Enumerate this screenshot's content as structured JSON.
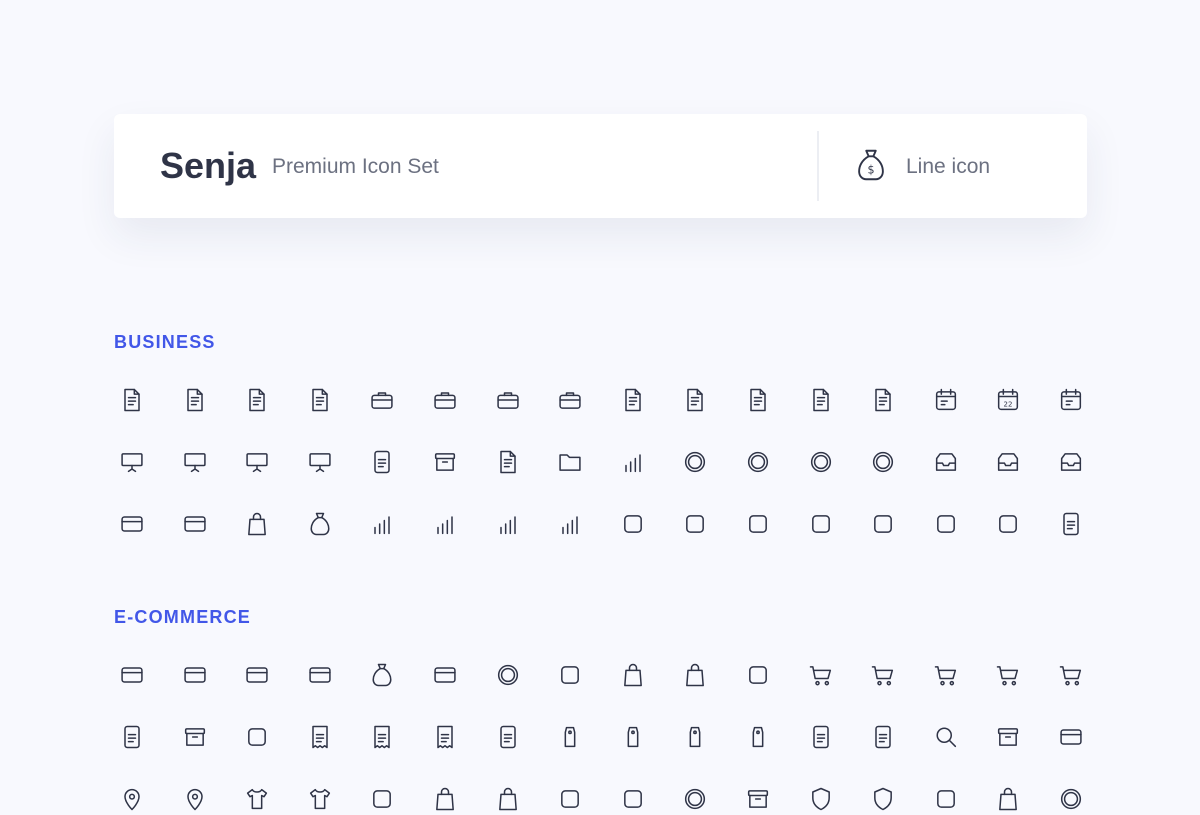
{
  "header": {
    "brand": "Senja",
    "tagline": "Premium Icon Set",
    "style_label": "Line icon",
    "style_icon": "money-bag-icon"
  },
  "colors": {
    "background": "#f8f9fe",
    "accent": "#4257e8",
    "icon_stroke": "#2f3447",
    "text_muted": "#6c7181"
  },
  "sections": [
    {
      "title": "BUSINESS",
      "icons": [
        "contact-book-icon",
        "address-book-at-icon",
        "checklist-document-icon",
        "document-lines-icon",
        "toolbox-icon",
        "briefcase-icon",
        "briefcase-rounded-icon",
        "suitcase-icon",
        "text-document-icon",
        "document-add-icon",
        "document-remove-icon",
        "document-check-icon",
        "document-delete-icon",
        "calendar-icon",
        "calendar-date-icon",
        "calendar-checklist-icon",
        "presentation-board-icon",
        "presentation-bar-chart-icon",
        "presentation-line-chart-icon",
        "presentation-down-chart-icon",
        "calculator-icon",
        "archive-drawer-icon",
        "list-document-icon",
        "folder-icon",
        "pie-chart-icon",
        "alarm-clock-icon",
        "dollar-coin-icon",
        "target-goal-icon",
        "crosshair-icon",
        "inbox-add-icon",
        "inbox-upload-icon",
        "inbox-mail-icon",
        "cash-stack-icon",
        "money-transfer-icon",
        "money-bag-icon",
        "piggy-bank-icon",
        "network-graph-icon",
        "line-growth-chart-icon",
        "bar-growth-chart-icon",
        "bar-chart-icon",
        "workflow-icon",
        "exchange-icon",
        "hand-dollar-icon",
        "hand-heart-icon",
        "megaphone-icon",
        "stamp-icon",
        "paint-roller-icon",
        "office-building-icon"
      ]
    },
    {
      "title": "E-COMMERCE",
      "icons": [
        "dollar-bill-icon",
        "credit-card-pay-icon",
        "credit-card-icon",
        "wallet-icon",
        "money-pouch-icon",
        "atm-cash-icon",
        "atm-bitcoin-icon",
        "store-icon",
        "shopping-bag-icon",
        "shopping-bag-handle-icon",
        "basket-icon",
        "shopping-cart-icon",
        "cart-download-icon",
        "cart-add-icon",
        "cart-remove-icon",
        "cart-forward-icon",
        "catalog-book-icon",
        "archive-box-icon",
        "delivery-truck-icon",
        "receipt-dollar-icon",
        "receipt-icon",
        "invoice-dollar-icon",
        "barcode-icon",
        "price-tag-icon",
        "tags-icon",
        "tag-add-icon",
        "tag-remove-icon",
        "clipboard-list-icon",
        "wishlist-clipboard-icon",
        "search-icon",
        "cashier-register-icon",
        "online-payment-monitor-icon",
        "location-pin-icon",
        "location-pin-outline-icon",
        "tshirt-icon",
        "shirt-icon",
        "awning-icon",
        "shopping-bag-closed-icon",
        "tote-bag-icon",
        "discount-badge-icon",
        "mobile-payment-icon",
        "reward-badge-icon",
        "gift-box-icon",
        "shield-check-icon",
        "shield-alert-icon",
        "bell-icon",
        "shopping-bag-small-icon",
        "timer-icon"
      ]
    }
  ]
}
